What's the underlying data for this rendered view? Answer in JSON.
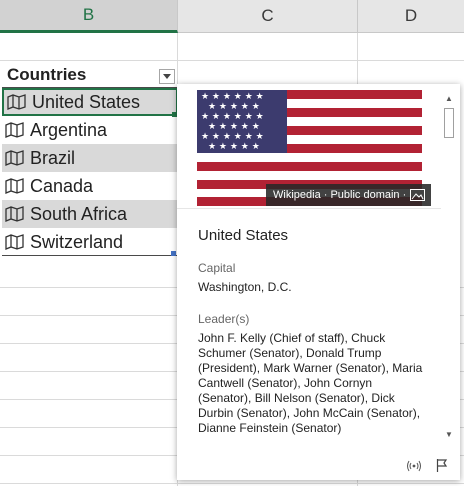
{
  "columns": [
    "B",
    "C",
    "D"
  ],
  "table": {
    "header": "Countries",
    "rows": [
      "United States",
      "Argentina",
      "Brazil",
      "Canada",
      "South Africa",
      "Switzerland"
    ]
  },
  "card": {
    "title": "United States",
    "attribution": "Wikipedia · Public domain ·",
    "fields": [
      {
        "label": "Capital",
        "value": "Washington, D.C."
      },
      {
        "label": "Leader(s)",
        "value": "John F. Kelly (Chief of staff), Chuck Schumer (Senator), Donald Trump (President), Mark Warner (Senator), Maria Cantwell (Senator), John Cornyn (Senator), Bill Nelson (Senator), Dick Durbin (Senator), John McCain (Senator), Dianne Feinstein (Senator)"
      }
    ]
  },
  "colors": {
    "accent": "#217346",
    "row_shade": "#d9d9d9",
    "flag_red": "#b22234",
    "flag_blue": "#3c3b6e"
  },
  "icons": {
    "row": "map-icon",
    "filter": "dropdown-arrow-icon",
    "image": "image-icon",
    "footer": [
      "wireless-icon",
      "flag-icon"
    ]
  }
}
